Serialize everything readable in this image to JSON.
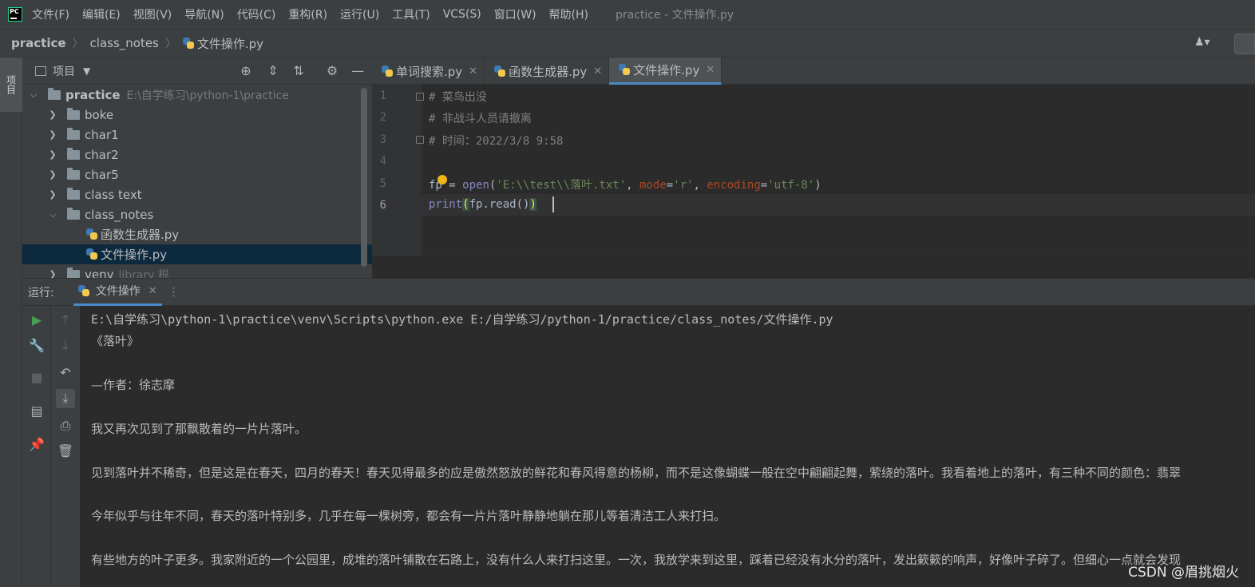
{
  "menubar": {
    "items": [
      "文件(F)",
      "编辑(E)",
      "视图(V)",
      "导航(N)",
      "代码(C)",
      "重构(R)",
      "运行(U)",
      "工具(T)",
      "VCS(S)",
      "窗口(W)",
      "帮助(H)"
    ],
    "window_title": "practice - 文件操作.py"
  },
  "breadcrumb": [
    "practice",
    "class_notes",
    "文件操作.py"
  ],
  "left_strip": {
    "project_label": "项目"
  },
  "project_panel": {
    "title": "项目",
    "tree": [
      {
        "label": "practice",
        "path": "E:\\自学练习\\python-1\\practice",
        "expanded": true
      },
      {
        "label": "boke"
      },
      {
        "label": "char1"
      },
      {
        "label": "char2"
      },
      {
        "label": "char5"
      },
      {
        "label": "class text"
      },
      {
        "label": "class_notes",
        "expanded": true
      },
      {
        "label": "函数生成器.py"
      },
      {
        "label": "文件操作.py",
        "selected": true
      },
      {
        "label": "venv",
        "sub": "library 根"
      }
    ]
  },
  "editor": {
    "tabs": [
      {
        "label": "单词搜索.py"
      },
      {
        "label": "函数生成器.py"
      },
      {
        "label": "文件操作.py",
        "active": true
      }
    ],
    "line_numbers": [
      "1",
      "2",
      "3",
      "4",
      "5",
      "6"
    ],
    "code": {
      "l1": "# 菜鸟出没",
      "l2": "# 非战斗人员请撤离",
      "l3": "# 时间：2022/3/8 9:58",
      "l5": {
        "var": "fp",
        "eq": " = ",
        "fn": "open",
        "p1": "(",
        "path": "'E:\\\\test\\\\落叶.txt'",
        "c1": ", ",
        "kw1": "mode",
        "eq1": "=",
        "mode": "'r'",
        "c2": ", ",
        "kw2": "encoding",
        "eq2": "=",
        "enc": "'utf-8'",
        "p2": ")"
      },
      "l6": {
        "fn": "print",
        "open": "(",
        "body": "fp.read()",
        "close": ")"
      }
    }
  },
  "run_panel": {
    "title": "运行:",
    "tab_label": "文件操作",
    "output": [
      "E:\\自学练习\\python-1\\practice\\venv\\Scripts\\python.exe E:/自学练习/python-1/practice/class_notes/文件操作.py",
      "《落叶》",
      "",
      "—作者：徐志摩",
      "",
      "我又再次见到了那飘散着的一片片落叶。",
      "",
      "见到落叶并不稀奇，但是这是在春天，四月的春天！春天见得最多的应是傲然怒放的鲜花和春风得意的杨柳，而不是这像蝴蝶一般在空中翩翩起舞，萦绕的落叶。我看着地上的落叶，有三种不同的颜色：翡翠",
      "",
      "今年似乎与往年不同，春天的落叶特别多，几乎在每一棵树旁，都会有一片片落叶静静地躺在那儿等着清洁工人来打扫。",
      "",
      "有些地方的叶子更多。我家附近的一个公园里，成堆的落叶铺散在石路上，没有什么人来打扫这里。一次，我放学来到这里，踩着已经没有水分的落叶，发出簌簌的响声，好像叶子碎了。但细心一点就会发现"
    ]
  },
  "watermark": "CSDN @眉挑烟火",
  "colors": {
    "accent": "#4a88c7",
    "comment": "#808080",
    "string": "#6a8759",
    "keyword_arg": "#aa4926",
    "builtin": "#8888c6"
  }
}
